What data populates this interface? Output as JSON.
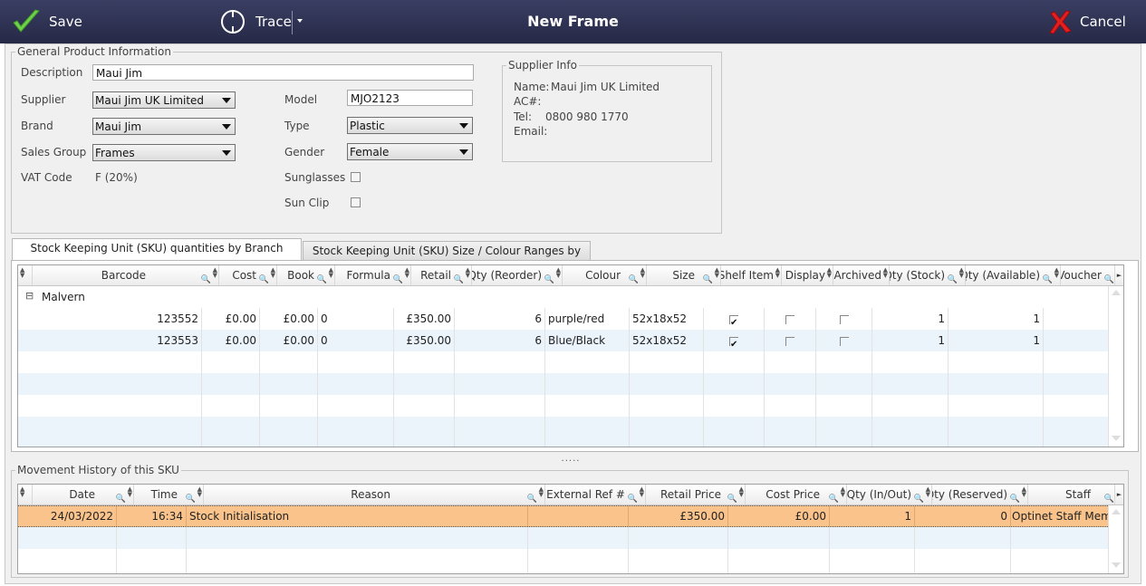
{
  "toolbar": {
    "save_label": "Save",
    "trace_label": "Trace",
    "title": "New Frame",
    "cancel_label": "Cancel",
    "save_icon": "checkmark-icon",
    "cancel_icon": "red-x-icon",
    "accent_dark": "#262946"
  },
  "general": {
    "legend": "General Product Information",
    "description_label": "Description",
    "description_value": "Maui Jim",
    "supplier_label": "Supplier",
    "supplier_value": "Maui Jim UK Limited",
    "brand_label": "Brand",
    "brand_value": "Maui Jim",
    "sales_group_label": "Sales Group",
    "sales_group_value": "Frames",
    "vat_label": "VAT Code",
    "vat_value": "F (20%)",
    "model_label": "Model",
    "model_value": "MJO2123",
    "type_label": "Type",
    "type_value": "Plastic",
    "gender_label": "Gender",
    "gender_value": "Female",
    "sunglasses_label": "Sunglasses",
    "sunglasses_checked": false,
    "sunclip_label": "Sun Clip",
    "sunclip_checked": false
  },
  "supplier_info": {
    "legend": "Supplier Info",
    "name_label": "Name:",
    "name_value": "Maui Jim UK Limited",
    "ac_label": "AC#:",
    "ac_value": "",
    "tel_label": "Tel:",
    "tel_value": "0800 980 1770",
    "email_label": "Email:",
    "email_value": ""
  },
  "tabs": {
    "tab1": "Stock Keeping Unit (SKU) quantities by Branch",
    "tab2": "Stock Keeping Unit (SKU) Size / Colour Ranges by Branch",
    "active": 0
  },
  "sku_grid": {
    "headers": {
      "barcode": "Barcode",
      "cost": "Cost",
      "book": "Book",
      "formula": "Formula",
      "retail": "Retail",
      "qty_reorder": "Qty (Reorder)",
      "colour": "Colour",
      "size": "Size",
      "shelf_item": "Shelf Item",
      "display": "Display",
      "archived": "Archived",
      "qty_stock": "Qty (Stock)",
      "qty_available": "Qty (Available)",
      "voucher": "Voucher"
    },
    "group_label": "Malvern",
    "group_toggle": "⊟",
    "rows": [
      {
        "barcode": "123552",
        "cost": "£0.00",
        "book": "£0.00",
        "formula": "0",
        "retail": "£350.00",
        "qty_reorder": "6",
        "colour": "purple/red",
        "size": "52x18x52",
        "shelf_item": true,
        "display": false,
        "archived": false,
        "qty_stock": "1",
        "qty_available": "1",
        "voucher": ""
      },
      {
        "barcode": "123553",
        "cost": "£0.00",
        "book": "£0.00",
        "formula": "0",
        "retail": "£350.00",
        "qty_reorder": "6",
        "colour": "Blue/Black",
        "size": "52x18x52",
        "shelf_item": true,
        "display": false,
        "archived": false,
        "qty_stock": "1",
        "qty_available": "1",
        "voucher": ""
      }
    ]
  },
  "splitter": ".....",
  "movement": {
    "legend": "Movement History of this SKU",
    "headers": {
      "date": "Date",
      "time": "Time",
      "reason": "Reason",
      "external_ref": "External Ref #",
      "retail_price": "Retail Price",
      "cost_price": "Cost Price",
      "qty_in_out": "Qty (In/Out)",
      "qty_reserved": "Qty (Reserved)",
      "staff": "Staff"
    },
    "rows": [
      {
        "date": "24/03/2022",
        "time": "16:34",
        "reason": "Stock Initialisation",
        "external_ref": "",
        "retail_price": "£350.00",
        "cost_price": "£0.00",
        "qty_in_out": "1",
        "qty_reserved": "0",
        "staff": "Optinet Staff Memb"
      }
    ],
    "selected_color": "#f9c38b"
  }
}
